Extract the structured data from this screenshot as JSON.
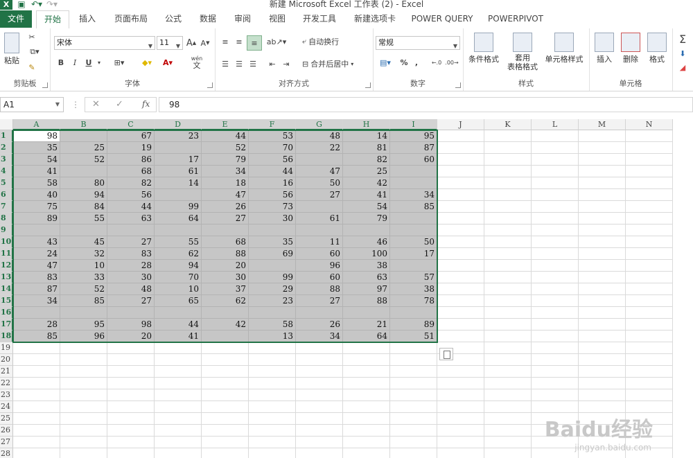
{
  "window": {
    "title": "新建 Microsoft Excel 工作表 (2) - Excel"
  },
  "tabs": [
    "文件",
    "开始",
    "插入",
    "页面布局",
    "公式",
    "数据",
    "审阅",
    "视图",
    "开发工具",
    "新建选项卡",
    "POWER QUERY",
    "POWERPIVOT"
  ],
  "ribbon": {
    "clipboard": {
      "paste": "粘贴",
      "label": "剪贴板"
    },
    "font": {
      "name": "宋体",
      "size": "11",
      "bold": "B",
      "italic": "I",
      "underline": "U",
      "label": "字体",
      "wen": "wén",
      "wen_char": "文",
      "grow": "A",
      "shrink": "A"
    },
    "align": {
      "wrap": "自动换行",
      "merge": "合并后居中",
      "label": "对齐方式"
    },
    "number": {
      "format": "常规",
      "percent": "%",
      "comma": ",",
      "label": "数字"
    },
    "styles": {
      "cond": "条件格式",
      "table1": "套用",
      "table2": "表格格式",
      "cell": "单元格样式",
      "label": "样式"
    },
    "cells": {
      "insert": "插入",
      "delete": "删除",
      "format": "格式",
      "label": "单元格"
    }
  },
  "formula_bar": {
    "name_box": "A1",
    "fx": "fx",
    "value": "98"
  },
  "columns": [
    "A",
    "B",
    "C",
    "D",
    "E",
    "F",
    "G",
    "H",
    "I",
    "J",
    "K",
    "L",
    "M",
    "N"
  ],
  "rows": [
    "1",
    "2",
    "3",
    "4",
    "5",
    "6",
    "7",
    "8",
    "9",
    "10",
    "11",
    "12",
    "13",
    "14",
    "15",
    "16",
    "17",
    "18",
    "19",
    "20",
    "21",
    "22",
    "23",
    "24",
    "25",
    "26",
    "27",
    "28"
  ],
  "cells": [
    [
      "98",
      "",
      "67",
      "23",
      "44",
      "53",
      "48",
      "14",
      "95"
    ],
    [
      "35",
      "25",
      "19",
      "",
      "52",
      "70",
      "22",
      "81",
      "87"
    ],
    [
      "54",
      "52",
      "86",
      "17",
      "79",
      "56",
      "",
      "82",
      "60"
    ],
    [
      "41",
      "",
      "68",
      "61",
      "34",
      "44",
      "47",
      "25",
      ""
    ],
    [
      "58",
      "80",
      "82",
      "14",
      "18",
      "16",
      "50",
      "42",
      ""
    ],
    [
      "40",
      "94",
      "56",
      "",
      "47",
      "56",
      "27",
      "41",
      "34"
    ],
    [
      "75",
      "84",
      "44",
      "99",
      "26",
      "73",
      "",
      "54",
      "85"
    ],
    [
      "89",
      "55",
      "63",
      "64",
      "27",
      "30",
      "61",
      "79",
      ""
    ],
    [
      "",
      "",
      "",
      "",
      "",
      "",
      "",
      "",
      ""
    ],
    [
      "43",
      "45",
      "27",
      "55",
      "68",
      "35",
      "11",
      "46",
      "50"
    ],
    [
      "24",
      "32",
      "83",
      "62",
      "88",
      "69",
      "60",
      "100",
      "17"
    ],
    [
      "47",
      "10",
      "28",
      "94",
      "20",
      "",
      "96",
      "38",
      ""
    ],
    [
      "83",
      "33",
      "30",
      "70",
      "30",
      "99",
      "60",
      "63",
      "57"
    ],
    [
      "87",
      "52",
      "48",
      "10",
      "37",
      "29",
      "88",
      "97",
      "38"
    ],
    [
      "34",
      "85",
      "27",
      "65",
      "62",
      "23",
      "27",
      "88",
      "78"
    ],
    [
      "",
      "",
      "",
      "",
      "",
      "",
      "",
      "",
      ""
    ],
    [
      "28",
      "95",
      "98",
      "44",
      "42",
      "58",
      "26",
      "21",
      "89"
    ],
    [
      "85",
      "96",
      "20",
      "41",
      "",
      "13",
      "34",
      "64",
      "51"
    ]
  ],
  "watermark": {
    "brand": "Baidu经验",
    "url": "jingyan.baidu.com"
  },
  "colors": {
    "accent": "#217346",
    "selection": "#c6c6c6"
  }
}
